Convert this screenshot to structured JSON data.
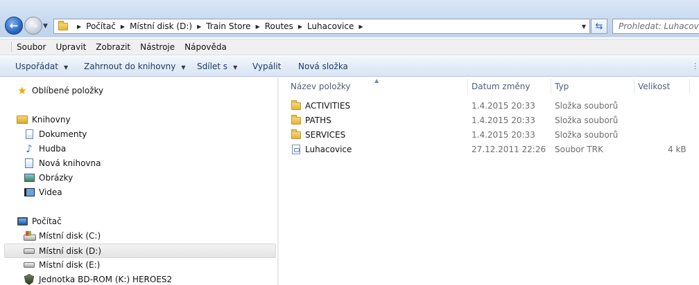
{
  "address": {
    "crumbs": [
      "Počítač",
      "Místní disk (D:)",
      "Train Store",
      "Routes",
      "Luhacovice"
    ],
    "search_placeholder": "Prohledat: Luhacovice"
  },
  "menu": [
    "Soubor",
    "Upravit",
    "Zobrazit",
    "Nástroje",
    "Nápověda"
  ],
  "commands": {
    "organize": "Uspořádat",
    "include_library": "Zahrnout do knihovny",
    "share": "Sdílet s",
    "burn": "Vypálit",
    "new_folder": "Nová složka"
  },
  "nav": {
    "favorites": "Oblíbené položky",
    "libraries": "Knihovny",
    "documents": "Dokumenty",
    "music": "Hudba",
    "new_library": "Nová knihovna",
    "pictures": "Obrázky",
    "videos": "Videa",
    "computer": "Počítač",
    "disk_c": "Místní disk (C:)",
    "disk_d": "Místní disk (D:)",
    "disk_e": "Místní disk (E:)",
    "bd_rom": "Jednotka BD-ROM (K:) HEROES2"
  },
  "columns": {
    "name": "Název položky",
    "date": "Datum změny",
    "type": "Typ",
    "size": "Velikost"
  },
  "files": [
    {
      "name": "ACTIVITIES",
      "date": "1.4.2015 20:33",
      "type": "Složka souborů",
      "size": ""
    },
    {
      "name": "PATHS",
      "date": "1.4.2015 20:33",
      "type": "Složka souborů",
      "size": ""
    },
    {
      "name": "SERVICES",
      "date": "1.4.2015 20:33",
      "type": "Složka souborů",
      "size": ""
    },
    {
      "name": "Luhacovice",
      "date": "27.12.2011 22:26",
      "type": "Soubor TRK",
      "size": "4 kB"
    }
  ]
}
